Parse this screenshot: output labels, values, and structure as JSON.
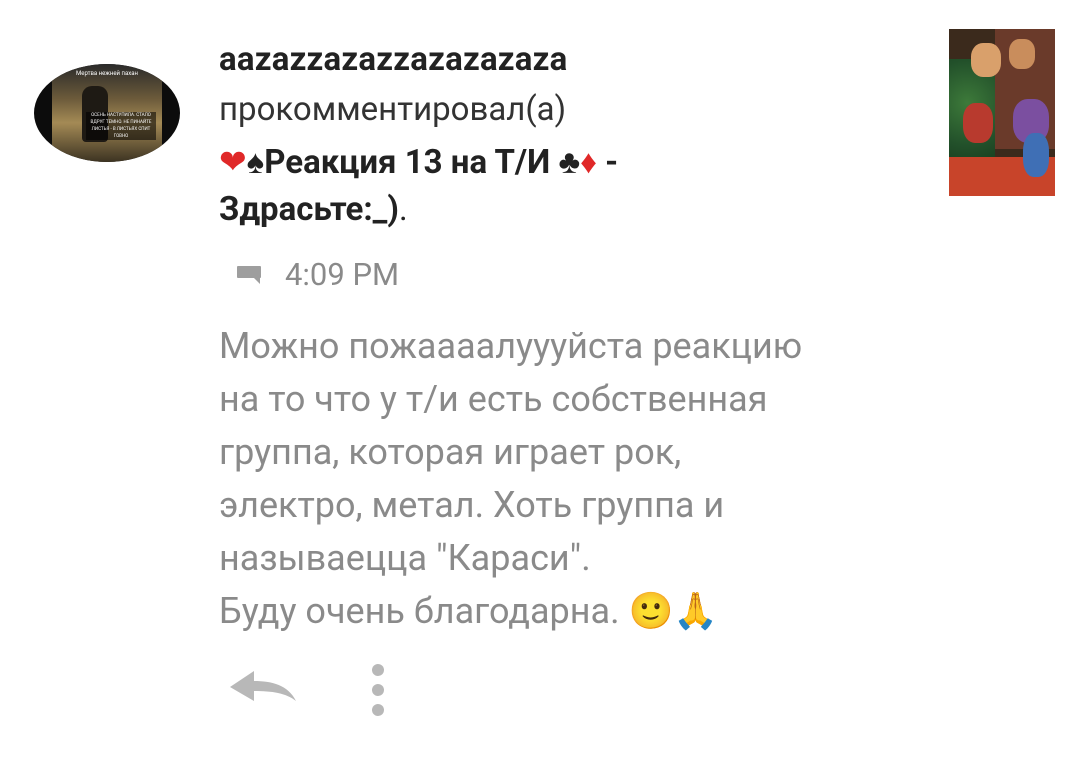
{
  "notification": {
    "username": "aazazzazazzazazazaza",
    "action": "прокомментировал(а)",
    "title_line1": {
      "heart": "❤",
      "spade": "♠",
      "text": "Реакция 13 на Т/И",
      "club": "♣",
      "diamond": "♦",
      "dash": "-"
    },
    "title_line2": {
      "text": "Здрасьте:_)",
      "period": "."
    },
    "time": "4:09 PM",
    "avatar_caption": "Мертва нежней пахан",
    "avatar_text": "ОСЕНЬ НАСТУПИЛА. СТАЛО ВДРУГ ТЕМНО. НЕ ПИНАЙТЕ ЛИСТЬЯ - В ЛИСТЬЯХ СПИТ ГОВНО"
  },
  "comment": {
    "lines": [
      "Можно пожаааалуууйста реакцию",
      "на то что у т/и есть собственная",
      "группа, которая играет рок,",
      "электро, метал. Хоть группа и",
      "называецца \"Караси\".",
      "Буду очень благодарна. 🙂🙏"
    ]
  },
  "actions": {
    "reply_icon": "reply-arrow-icon",
    "more_icon": "more-vertical-icon"
  },
  "colors": {
    "text_dark": "#222222",
    "text_muted": "#8a8a8a",
    "icon_gray": "#b8b8b8",
    "suit_red": "#e02828"
  }
}
